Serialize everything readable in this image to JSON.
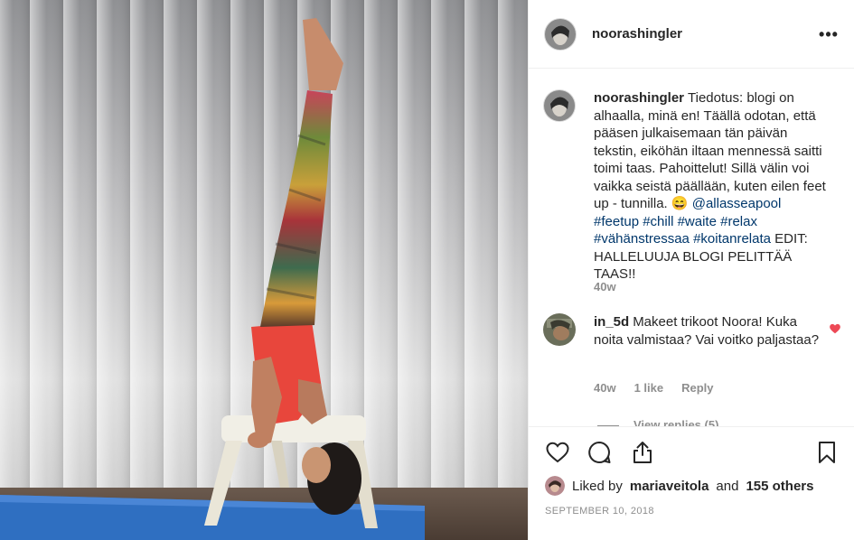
{
  "post": {
    "author": "noorashingler",
    "more_label": "•••"
  },
  "caption": {
    "username": "noorashingler",
    "text_part1": "Tiedotus: blogi on alhaalla, minä en! Täällä odotan, että pääsen julkaisemaan tän päivän tekstin, eiköhän iltaan mennessä saitti toimi taas. Pahoittelut! Sillä välin voi vaikka seistä päällään, kuten eilen feet up - tunnilla. 😄",
    "tags": [
      "@allasseapool",
      "#feetup",
      "#chill",
      "#waite",
      "#relax",
      "#vähänstressaa",
      "#koitanrelata"
    ],
    "text_part2": "EDIT: HALLELUUJA BLOGI PELITTÄÄ TAAS!!",
    "time": "40w"
  },
  "comment1": {
    "username": "in_5d",
    "text": "Makeet trikoot Noora! Kuka noita valmistaa? Vai voitko paljastaa?",
    "time": "40w",
    "likes": "1 like",
    "reply": "Reply"
  },
  "view_replies": "View replies (5)",
  "likes": {
    "prefix": "Liked by",
    "user": "mariaveitola",
    "and": "and",
    "others": "155 others"
  },
  "date": "SEPTEMBER 10, 2018",
  "colors": {
    "like_red": "#ed4956",
    "link_blue": "#00376b",
    "mat_blue": "#2f6fc1",
    "legging_red": "#e8463c"
  },
  "icons": [
    "heart-icon",
    "comment-icon",
    "share-icon",
    "bookmark-icon",
    "more-icon"
  ]
}
